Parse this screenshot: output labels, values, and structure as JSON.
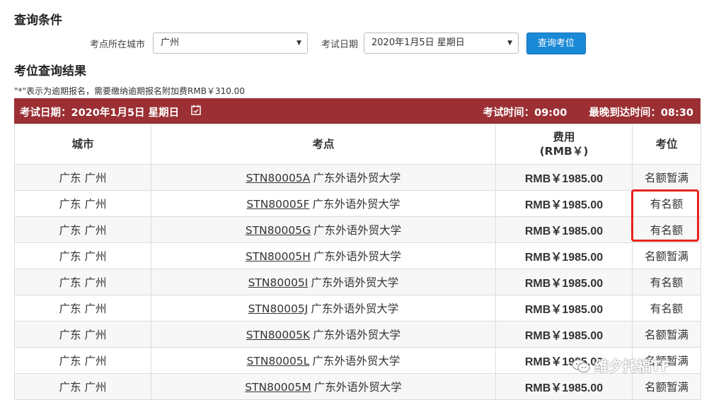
{
  "query_section": {
    "title": "查询条件",
    "city_label": "考点所在城市",
    "city_value": "广州",
    "date_label": "考试日期",
    "date_value": "2020年1月5日 星期日",
    "query_button": "查询考位"
  },
  "result_section": {
    "title": "考位查询结果",
    "note": "\"*\"表示为逾期报名，需要缴纳逾期报名附加费RMB￥310.00"
  },
  "banner": {
    "exam_date": "考试日期：2020年1月5日 星期日",
    "exam_time": "考试时间：09:00",
    "latest_arrival": "最晚到达时间：08:30"
  },
  "table": {
    "headers": {
      "city": "城市",
      "center": "考点",
      "fee_line1": "费用",
      "fee_line2": "(RMB￥)",
      "seat": "考位"
    },
    "rows": [
      {
        "city": "广东 广州",
        "code": "STN80005A",
        "name": "广东外语外贸大学",
        "fee": "RMB￥1985.00",
        "seat": "名额暂满"
      },
      {
        "city": "广东 广州",
        "code": "STN80005F",
        "name": "广东外语外贸大学",
        "fee": "RMB￥1985.00",
        "seat": "有名额"
      },
      {
        "city": "广东 广州",
        "code": "STN80005G",
        "name": "广东外语外贸大学",
        "fee": "RMB￥1985.00",
        "seat": "有名额"
      },
      {
        "city": "广东 广州",
        "code": "STN80005H",
        "name": "广东外语外贸大学",
        "fee": "RMB￥1985.00",
        "seat": "名额暂满"
      },
      {
        "city": "广东 广州",
        "code": "STN80005I",
        "name": "广东外语外贸大学",
        "fee": "RMB￥1985.00",
        "seat": "有名额"
      },
      {
        "city": "广东 广州",
        "code": "STN80005J",
        "name": "广东外语外贸大学",
        "fee": "RMB￥1985.00",
        "seat": "有名额"
      },
      {
        "city": "广东 广州",
        "code": "STN80005K",
        "name": "广东外语外贸大学",
        "fee": "RMB￥1985.00",
        "seat": "名额暂满"
      },
      {
        "city": "广东 广州",
        "code": "STN80005L",
        "name": "广东外语外贸大学",
        "fee": "RMB￥1985.00",
        "seat": "名额暂满"
      },
      {
        "city": "广东 广州",
        "code": "STN80005M",
        "name": "广东外语外贸大学",
        "fee": "RMB￥1985.00",
        "seat": "名额暂满"
      }
    ]
  },
  "watermark": {
    "text": "维夕托福TF"
  },
  "colors": {
    "banner": "#9b2f33",
    "button": "#1a8ad6",
    "highlight": "#e8231e"
  },
  "icons": {
    "calendar": "calendar-check-icon",
    "dropdown": "caret-down-icon",
    "wechat": "wechat-icon"
  }
}
